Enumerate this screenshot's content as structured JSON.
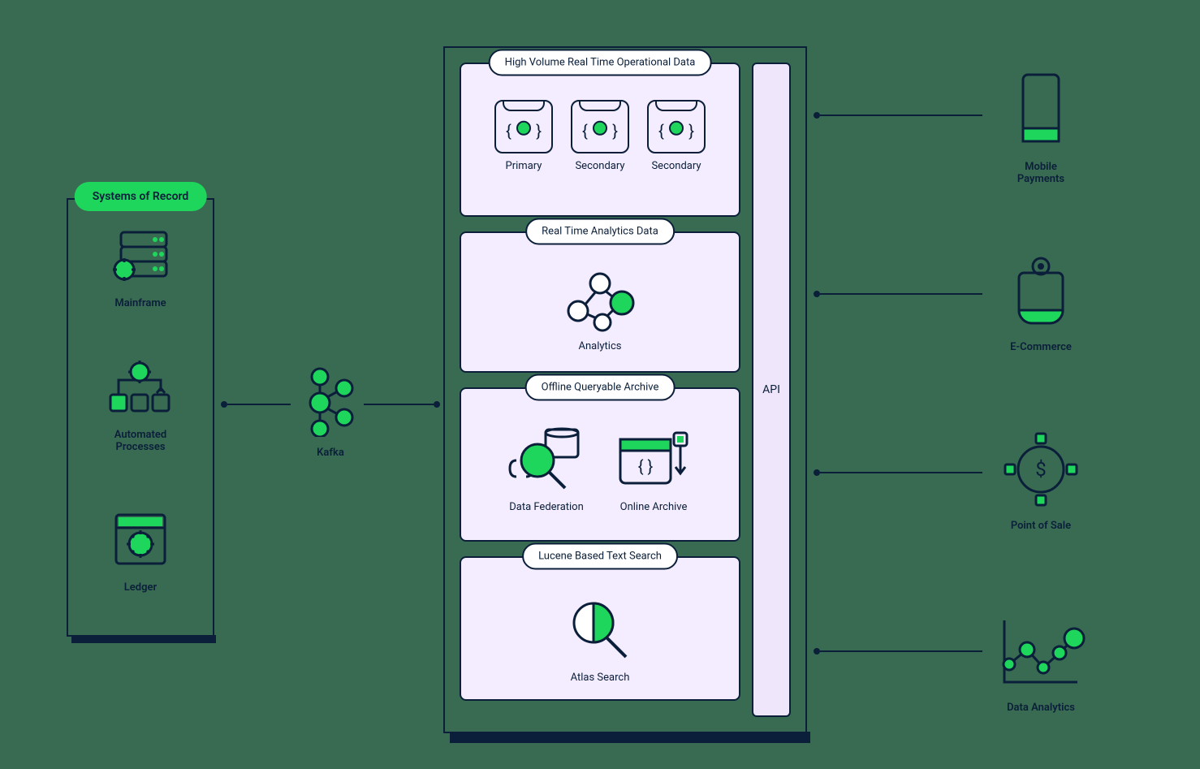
{
  "left_panel": {
    "title": "Systems of Record",
    "items": [
      {
        "label": "Mainframe"
      },
      {
        "label": "Automated\nProcesses"
      },
      {
        "label": "Ledger"
      }
    ]
  },
  "kafka": {
    "label": "Kafka"
  },
  "center": {
    "api_label": "API",
    "sections": [
      {
        "title": "High Volume Real Time Operational Data",
        "nodes": [
          {
            "label": "Primary"
          },
          {
            "label": "Secondary"
          },
          {
            "label": "Secondary"
          }
        ]
      },
      {
        "title": "Real Time Analytics Data",
        "nodes": [
          {
            "label": "Analytics"
          }
        ]
      },
      {
        "title": "Offline Queryable Archive",
        "nodes": [
          {
            "label": "Data Federation"
          },
          {
            "label": "Online Archive"
          }
        ]
      },
      {
        "title": "Lucene Based Text Search",
        "nodes": [
          {
            "label": "Atlas Search"
          }
        ]
      }
    ]
  },
  "consumers": [
    {
      "label": "Mobile\nPayments"
    },
    {
      "label": "E-Commerce"
    },
    {
      "label": "Point of Sale"
    },
    {
      "label": "Data Analytics"
    }
  ]
}
